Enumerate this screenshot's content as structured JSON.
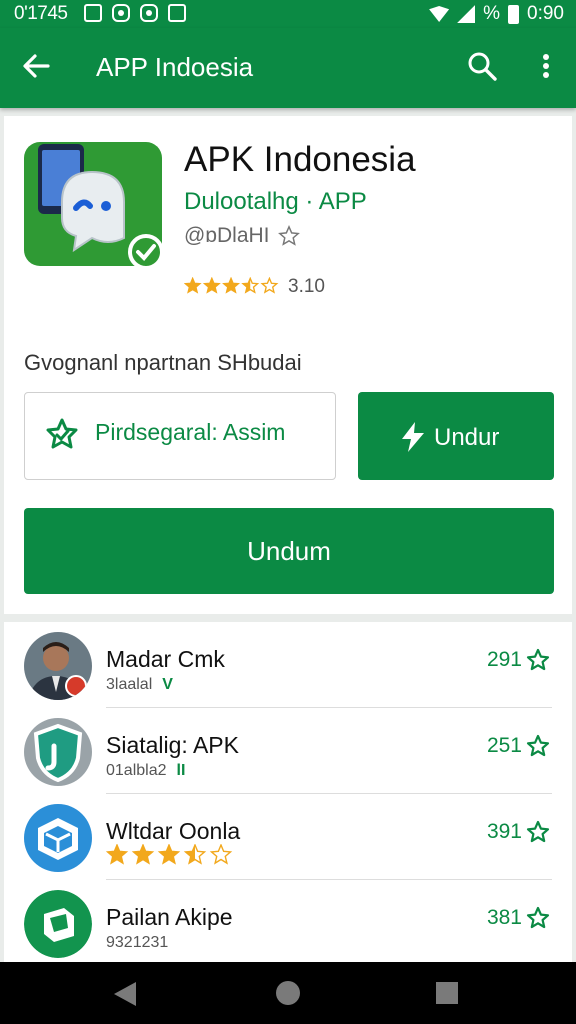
{
  "status_bar": {
    "time_left": "0'1745",
    "time_right": "0:90",
    "percent": "%"
  },
  "app_bar": {
    "title": "APP Indoesia"
  },
  "app": {
    "name": "APK Indonesia",
    "developer": "Dulootalhg · APP",
    "handle": "@ɒDlaHI",
    "rating_value": 3.5,
    "rating_text": "3.10",
    "section_label": "Gvognanl npartnan SHbudai",
    "secondary_button": "Pirdsegaral: Assim",
    "undur_button": "Undur",
    "download_button": "Undum"
  },
  "list": [
    {
      "name": "Madar Cmk",
      "sub": "3laalal",
      "mark": "V",
      "count": "291",
      "rating": null
    },
    {
      "name": "Siatalig: APK",
      "sub": "01albla2",
      "mark": "lI",
      "count": "251",
      "rating": null
    },
    {
      "name": "Wltdar Oonla",
      "sub": "",
      "mark": "",
      "count": "391",
      "rating": 3.5
    },
    {
      "name": "Pailan Akipe",
      "sub": "9321231",
      "mark": "",
      "count": "381",
      "rating": null
    }
  ],
  "colors": {
    "primary": "#0b8a44",
    "star": "#f2a81c"
  }
}
